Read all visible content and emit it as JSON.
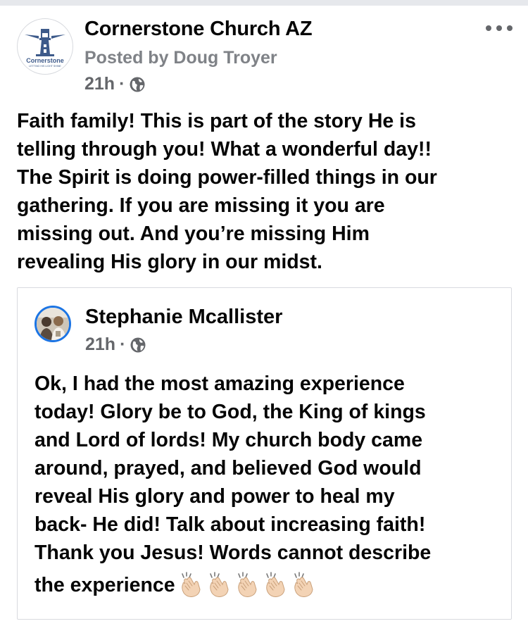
{
  "post": {
    "page_name": "Cornerstone Church AZ",
    "posted_by": "Posted by Doug Troyer",
    "time": "21h",
    "dot": "·",
    "logo_text": "Cornerstone",
    "logo_tagline": "LETTING HIS LIGHT SHINE",
    "body_lines": [
      "Faith family! This is part of the story He is",
      "telling through you! What a wonderful day!!",
      "The Spirit is doing power-filled things in our",
      "gathering. If you are missing it you are",
      "missing out. And you’re missing Him",
      "revealing His glory in our midst."
    ]
  },
  "shared": {
    "author": "Stephanie Mcallister",
    "time": "21h",
    "dot": "·",
    "body_lines": [
      "Ok, I had the most amazing experience",
      "today!  Glory be to God, the King of kings",
      "and Lord of lords!  My church body came",
      "around, prayed, and believed God would",
      "reveal His glory and power to heal my",
      "back- He did! Talk about increasing faith!",
      "Thank you Jesus! Words cannot describe"
    ],
    "last_line": "the experience",
    "emoji": [
      "clapping-hands",
      "clapping-hands",
      "clapping-hands",
      "clapping-hands",
      "clapping-hands"
    ]
  },
  "colors": {
    "text": "#050505",
    "secondary": "#65676b",
    "accent": "#1b74e4",
    "logo_blue": "#3d5a8a"
  }
}
